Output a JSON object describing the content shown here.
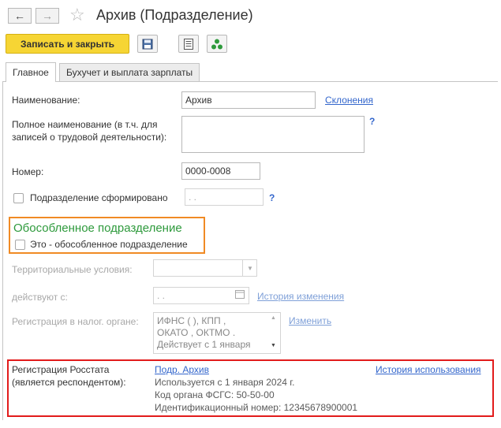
{
  "window": {
    "title": "Архив (Подразделение)"
  },
  "toolbar": {
    "save_close_label": "Записать и закрыть"
  },
  "tabs": [
    {
      "label": "Главное"
    },
    {
      "label": "Бухучет и выплата зарплаты"
    }
  ],
  "form": {
    "name_label": "Наименование:",
    "name_value": "Архив",
    "declensions_link": "Склонения",
    "fullname_label_line1": "Полное наименование (в т.ч. для",
    "fullname_label_line2": "записей о трудовой деятельности):",
    "fullname_value": "",
    "help_mark": "?",
    "number_label": "Номер:",
    "number_value": "0000-0008",
    "formed_label": "Подразделение сформировано",
    "formed_date": " .  .",
    "separate_title": "Обособленное подразделение",
    "separate_checkbox_label": "Это - обособленное подразделение",
    "territorial_label": "Территориальные условия:",
    "territorial_value": "",
    "valid_from_label": "действуют с:",
    "valid_from_value": " .  .",
    "history_link": "История изменения",
    "tax_reg_label": "Регистрация в налог. органе:",
    "tax_reg_lines": [
      "ИФНС (    ), КПП ,",
      "ОКАТО , ОКТМО .",
      "Действует с 1 января"
    ],
    "change_link": "Изменить",
    "rosstat_label_line1": "Регистрация Росстата",
    "rosstat_label_line2": "(является респондентом):",
    "rosstat_link": "Подр. Архив",
    "rosstat_history_link": "История использования",
    "rosstat_info": [
      "Используется с 1 января 2024 г.",
      "Код органа ФСГС: 50-50-00",
      "Идентификационный номер: 12345678900001"
    ]
  },
  "colors": {
    "highlight_orange": "#f08a24",
    "highlight_red": "#e21b1b",
    "accent_yellow": "#f6d534",
    "link_blue": "#3366cc",
    "section_green": "#2e9a3c"
  }
}
